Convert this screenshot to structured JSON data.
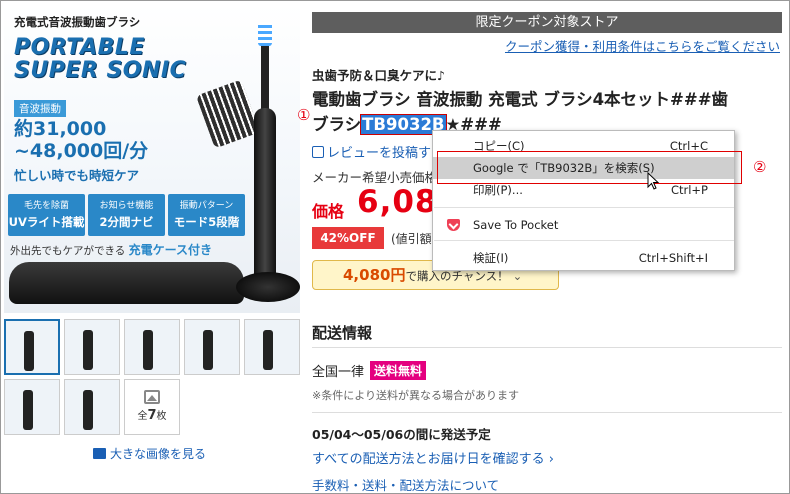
{
  "hero": {
    "tag": "充電式音波振動歯ブラシ",
    "title": "PORTABLE SUPER SONIC",
    "wave_label": "音波振動",
    "frequency": "約31,000 ~48,000回/分",
    "subline": "忙しい時でも時短ケア",
    "badges": [
      {
        "small": "毛先を除菌",
        "big": "UVライト搭載"
      },
      {
        "small": "お知らせ機能",
        "big": "2分間ナビ"
      },
      {
        "small": "振動パターン",
        "big": "モード5段階"
      }
    ],
    "case_text": "外出先でもケアができる",
    "case_highlight": "充電ケース付き"
  },
  "thumbs": {
    "all_label": "全",
    "all_count": "7",
    "all_unit": "枚",
    "view_large": "大きな画像を見る"
  },
  "store_bar": "限定クーポン対象ストア",
  "coupon_link": "クーポン獲得・利用条件はこちらをご覧ください",
  "product": {
    "preview": "虫歯予防＆口臭ケアに♪",
    "title_line1": "電動歯ブラシ 音波振動 充電式 ブラシ4本セット###歯",
    "title_pre": "ブラシ",
    "title_selected": "TB9032B",
    "title_post": "★###",
    "review_link": "レビューを投稿す",
    "msrp": "メーカー希望小売価格：",
    "price_label": "価格",
    "price": "6,080",
    "off_badge": "42%OFF",
    "tax_note": "(値引額",
    "chance_price": "4,080円",
    "chance_text": "で購入のチャンス！",
    "chance_chevron": "⌄"
  },
  "annotations": {
    "one": "①",
    "two": "②"
  },
  "shipping": {
    "heading": "配送情報",
    "region": "全国一律",
    "free_badge": "送料無料",
    "note": "※条件により送料が異なる場合があります",
    "date": "05/04～05/06の間に発送予定",
    "link_methods": "すべての配送方法とお届け日を確認する ›",
    "link_fees": "手数料・送料・配送方法について"
  },
  "context_menu": {
    "items": [
      {
        "label": "コピー(C)",
        "shortcut": "Ctrl+C"
      },
      {
        "label": "Google で「TB9032B」を検索(S)",
        "shortcut": ""
      },
      {
        "label": "印刷(P)...",
        "shortcut": "Ctrl+P"
      },
      {
        "label": "Save To Pocket",
        "shortcut": ""
      },
      {
        "label": "検証(I)",
        "shortcut": "Ctrl+Shift+I"
      }
    ]
  },
  "colors": {
    "price_red": "#e60012",
    "link_blue": "#1a5fb4",
    "store_bar": "#5e5e5e",
    "free_ship_pink": "#e4007f",
    "selection_blue": "#2b7bd6"
  }
}
